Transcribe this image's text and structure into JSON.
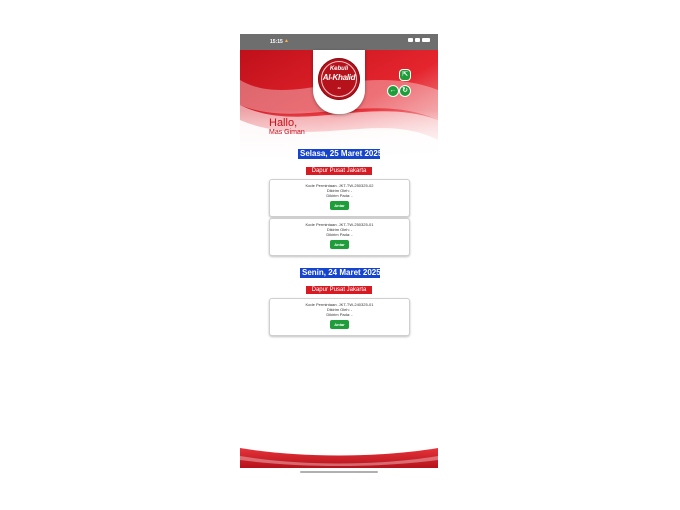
{
  "status_bar": {
    "time": "15:15",
    "notif_icon": "warning-icon"
  },
  "brand": {
    "logo_line1": "Kebuli",
    "logo_line2": "Al-Khalid",
    "logo_small": "Jkt",
    "primary_red": "#d81a22",
    "dark_red": "#b5121b"
  },
  "header": {
    "export_icon": "export-icon",
    "back_icon": "arrow-left-icon",
    "refresh_icon": "refresh-icon"
  },
  "greeting": {
    "hallo": "Hallo,",
    "name": "Mas Giman"
  },
  "groups": [
    {
      "date": "Selasa, 25 Maret 2025",
      "location": "Dapur Pusat Jakarta",
      "cards": [
        {
          "kode": "Kode Permintaan: JKT-TW-250325-02",
          "dikirim_oleh": "Dikirim Oleh: -",
          "dikirim_pada": "Dikirim Pada: -",
          "button": "Antar"
        },
        {
          "kode": "Kode Permintaan: JKT-TW-250325-01",
          "dikirim_oleh": "Dikirim Oleh: -",
          "dikirim_pada": "Dikirim Pada: -",
          "button": "Antar"
        }
      ]
    },
    {
      "date": "Senin, 24 Maret 2025",
      "location": "Dapur Pusat Jakarta",
      "cards": [
        {
          "kode": "Kode Permintaan: JKT-TW-240325-01",
          "dikirim_oleh": "Dikirim Oleh: -",
          "dikirim_pada": "Dikirim Pada: -",
          "button": "Antar"
        }
      ]
    }
  ],
  "colors": {
    "date_badge_blue": "#1544cf",
    "button_green": "#1f9d3a"
  }
}
